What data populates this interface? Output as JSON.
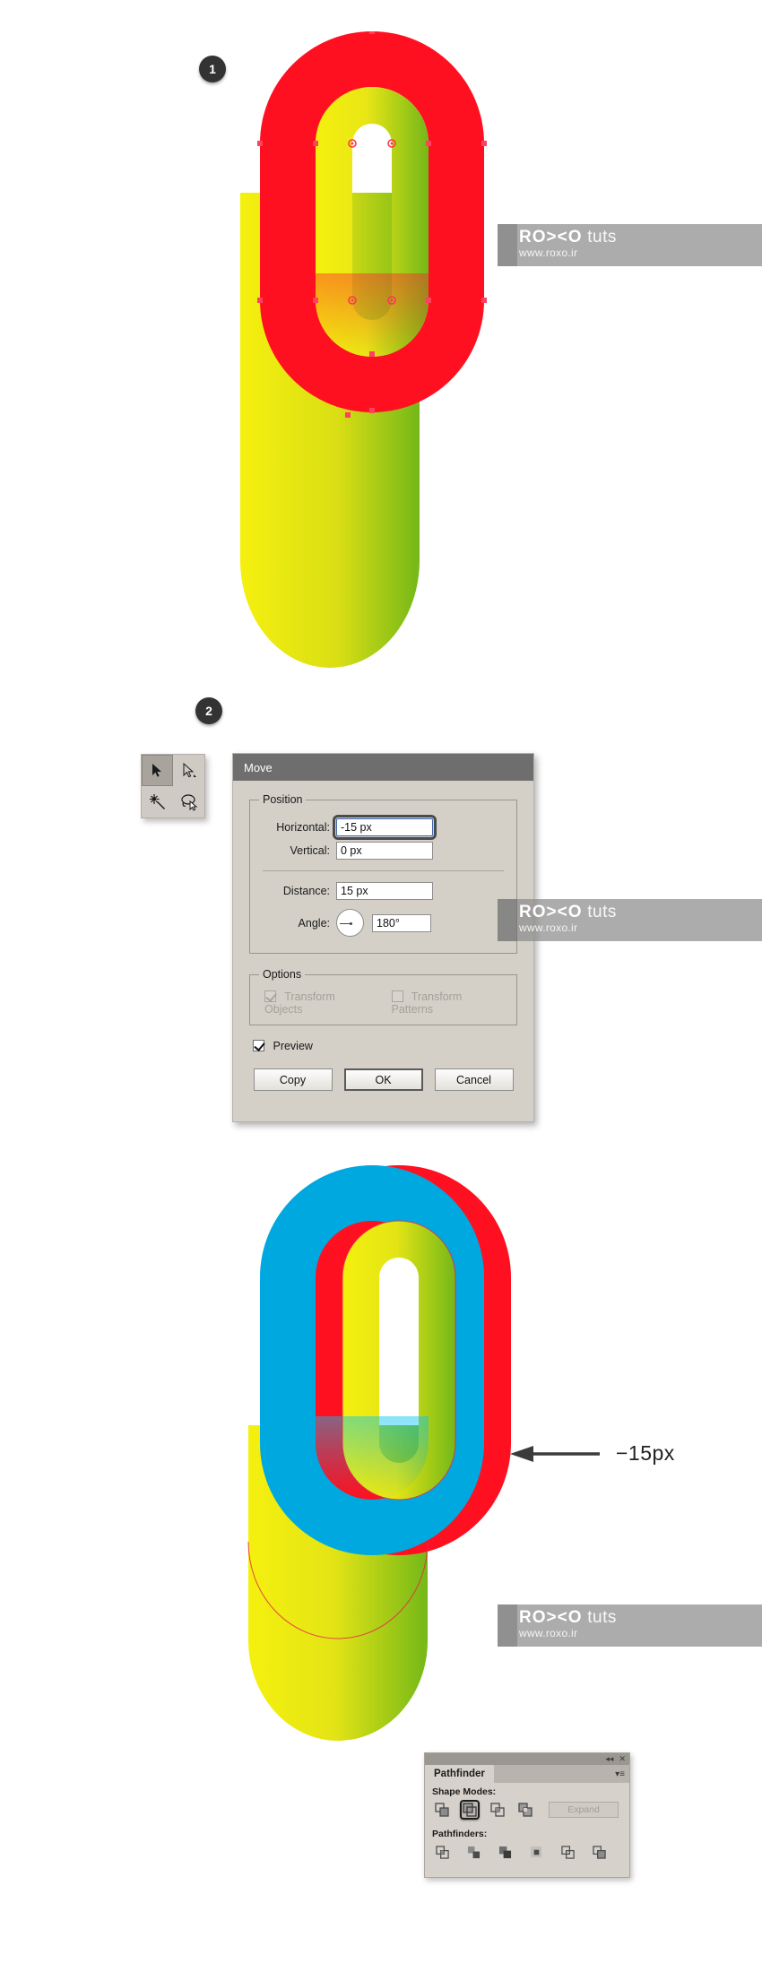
{
  "steps": [
    {
      "number": "1"
    },
    {
      "number": "2"
    }
  ],
  "watermarks": [
    {
      "brand_bold": "RO><O",
      "brand_light": "tuts",
      "url": "www.roxo.ir"
    },
    {
      "brand_bold": "RO><O",
      "brand_light": "tuts",
      "url": "www.roxo.ir"
    },
    {
      "brand_bold": "RO><O",
      "brand_light": "tuts",
      "url": "www.roxo.ir"
    }
  ],
  "dialog": {
    "title": "Move",
    "position_group": "Position",
    "horizontal_label": "Horizontal:",
    "horizontal_value": "-15 px",
    "vertical_label": "Vertical:",
    "vertical_value": "0 px",
    "distance_label": "Distance:",
    "distance_value": "15 px",
    "angle_label": "Angle:",
    "angle_value": "180°",
    "options_group": "Options",
    "transform_objects_label": "Transform Objects",
    "transform_patterns_label": "Transform Patterns",
    "preview_label": "Preview",
    "copy_button": "Copy",
    "ok_button": "OK",
    "cancel_button": "Cancel"
  },
  "tool_palette": {
    "tools": [
      {
        "name": "selection-tool",
        "selected": true
      },
      {
        "name": "direct-selection-tool",
        "selected": false
      },
      {
        "name": "magic-wand-tool",
        "selected": false
      },
      {
        "name": "lasso-tool",
        "selected": false
      }
    ]
  },
  "annotation": {
    "label": "−15px"
  },
  "pathfinder": {
    "tab_title": "Pathfinder",
    "shape_modes_label": "Shape Modes:",
    "pathfinders_label": "Pathfinders:",
    "expand_button": "Expand",
    "collapse_icon": "◂◂",
    "close_icon": "✕",
    "menu_icon": "▾≡",
    "shape_modes": [
      {
        "name": "unite",
        "selected": false
      },
      {
        "name": "minus-front",
        "selected": true
      },
      {
        "name": "intersect",
        "selected": false
      },
      {
        "name": "exclude",
        "selected": false
      }
    ],
    "pathfinder_ops": [
      {
        "name": "divide"
      },
      {
        "name": "trim"
      },
      {
        "name": "merge"
      },
      {
        "name": "crop"
      },
      {
        "name": "outline"
      },
      {
        "name": "minus-back"
      }
    ]
  },
  "colors": {
    "red": "#FF1020",
    "cyan": "#00A8E0",
    "yellow": "#F2EA1E",
    "green": "#7FBF1A",
    "badge": "#333333",
    "dialog_bg": "#D4D0C8",
    "dialog_title_bg": "#6E6E6E",
    "watermark_bg": "#8C8C8C",
    "anchor": "#FF3355"
  },
  "artworks": [
    {
      "name": "artwork-step-1",
      "description": "red-outer-shape-with-yellow-green-gradient-inner-letter-and-anchor-points"
    },
    {
      "name": "artwork-step-3",
      "description": "cyan-duplicate-offset-left-over-red-and-yellow-green-letter"
    }
  ]
}
